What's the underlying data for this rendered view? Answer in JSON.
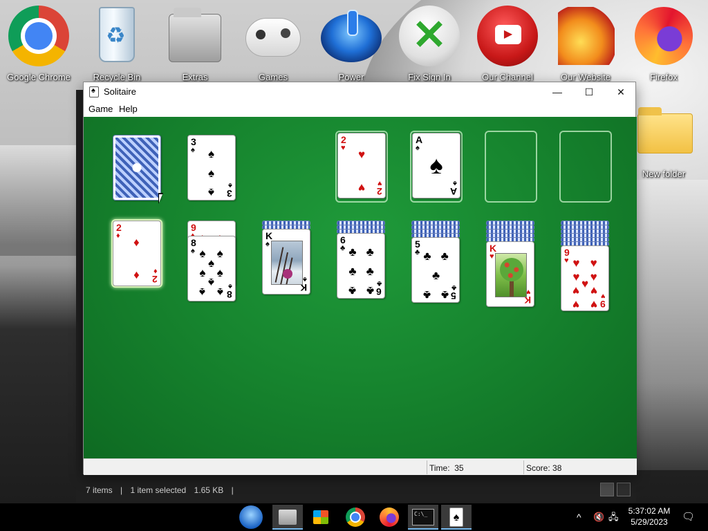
{
  "desktop": {
    "icons": [
      {
        "label": "Google Chrome",
        "icon": "chrome-icon"
      },
      {
        "label": "Recycle Bin",
        "icon": "recycle-bin-icon"
      },
      {
        "label": "Extras",
        "icon": "folder-icon"
      },
      {
        "label": "Games",
        "icon": "gamepad-icon"
      },
      {
        "label": "Power",
        "icon": "power-icon"
      },
      {
        "label": "Fix Sign In",
        "icon": "xbox-icon"
      },
      {
        "label": "Our Channel",
        "icon": "youtube-icon"
      },
      {
        "label": "Our Website",
        "icon": "phoenix-icon"
      },
      {
        "label": "Firefox",
        "icon": "firefox-icon"
      },
      {
        "label": "New folder",
        "icon": "folder-icon"
      }
    ]
  },
  "explorer": {
    "items_count": "7 items",
    "selection": "1 item selected",
    "size": "1.65 KB",
    "separator": "|"
  },
  "window": {
    "title": "Solitaire",
    "controls": {
      "minimize": "—",
      "maximize": "☐",
      "close": "✕"
    },
    "menu": [
      "Game",
      "Help"
    ]
  },
  "game": {
    "stock": {
      "face_down": true
    },
    "waste": {
      "rank": "3",
      "suit": "♠",
      "color": "black"
    },
    "foundations": [
      {
        "rank": "2",
        "suit": "♥",
        "color": "red"
      },
      {
        "rank": "A",
        "suit": "♠",
        "color": "black"
      },
      {
        "empty": true
      },
      {
        "empty": true
      }
    ],
    "tableau": [
      {
        "hidden": 0,
        "cards": [
          {
            "rank": "2",
            "suit": "♦",
            "color": "red"
          }
        ]
      },
      {
        "hidden": 0,
        "cards": [
          {
            "rank": "9",
            "suit": "♦",
            "color": "red"
          },
          {
            "rank": "8",
            "suit": "♠",
            "color": "black"
          }
        ]
      },
      {
        "hidden": 2,
        "cards": [
          {
            "rank": "K",
            "suit": "♠",
            "color": "black"
          }
        ]
      },
      {
        "hidden": 3,
        "cards": [
          {
            "rank": "6",
            "suit": "♣",
            "color": "black"
          }
        ]
      },
      {
        "hidden": 4,
        "cards": [
          {
            "rank": "5",
            "suit": "♣",
            "color": "black"
          }
        ]
      },
      {
        "hidden": 5,
        "cards": [
          {
            "rank": "K",
            "suit": "♥",
            "color": "red"
          }
        ]
      },
      {
        "hidden": 6,
        "cards": [
          {
            "rank": "9",
            "suit": "♥",
            "color": "red"
          }
        ]
      }
    ],
    "felt_color": "#17862f"
  },
  "status": {
    "time_label": "Time:",
    "time_value": "35",
    "score_label": "Score:",
    "score_value": "38"
  },
  "taskbar": {
    "apps": [
      {
        "name": "start-button",
        "icon": "windows-orb-icon"
      },
      {
        "name": "file-explorer",
        "icon": "file-explorer-icon"
      },
      {
        "name": "store",
        "icon": "store-icon"
      },
      {
        "name": "chrome",
        "icon": "chrome-icon"
      },
      {
        "name": "firefox",
        "icon": "firefox-icon"
      },
      {
        "name": "command-prompt",
        "icon": "cmd-icon",
        "text": "C:\\_"
      },
      {
        "name": "solitaire",
        "icon": "solitaire-icon",
        "active": true
      }
    ],
    "tray": {
      "chevron": "^",
      "volume_icon": "volume-muted-icon",
      "network_icon": "network-icon",
      "notification_icon": "notification-icon"
    },
    "clock": {
      "time": "5:37:02 AM",
      "date": "5/29/2023"
    }
  }
}
